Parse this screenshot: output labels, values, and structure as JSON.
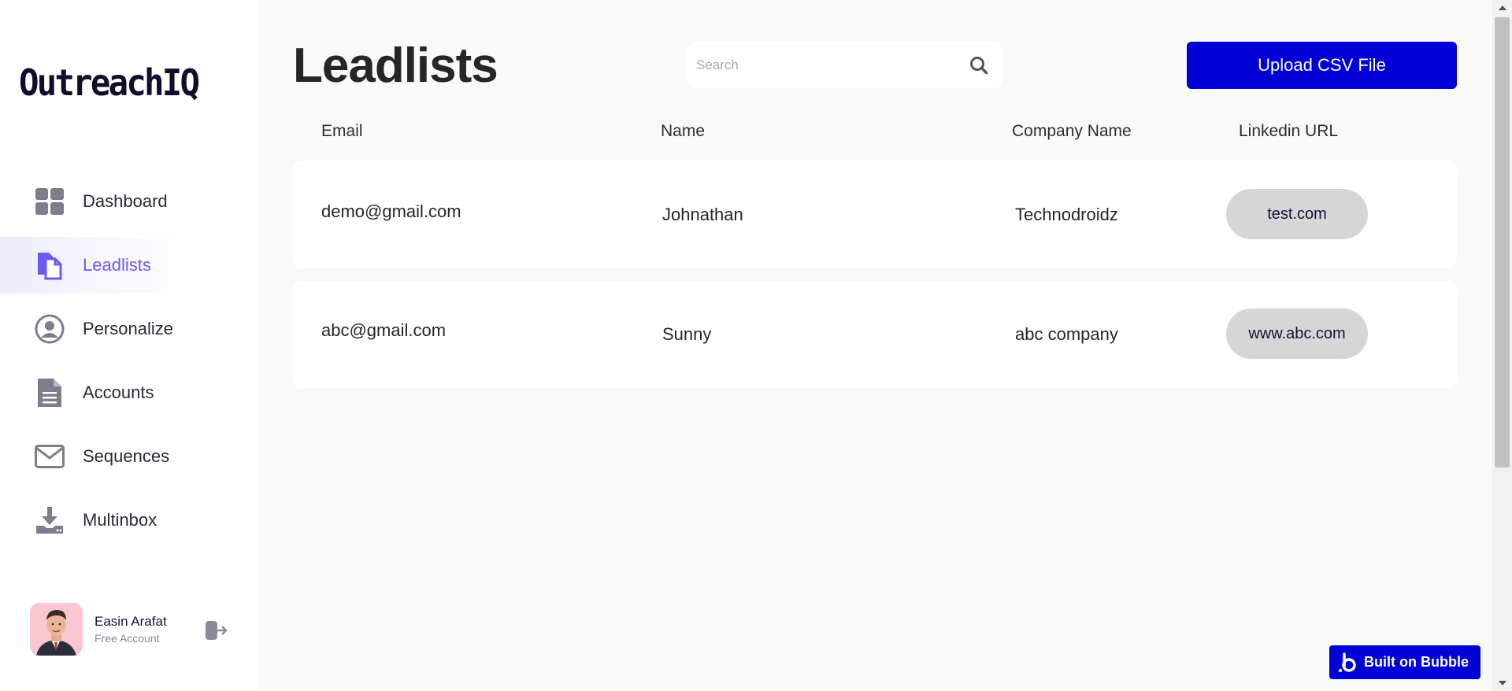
{
  "sidebar": {
    "logo": "OutreachIQ",
    "items": [
      {
        "label": "Dashboard",
        "icon": "dashboard-grid-icon"
      },
      {
        "label": "Leadlists",
        "icon": "leadlists-icon",
        "active": true
      },
      {
        "label": "Personalize",
        "icon": "user-circle-icon"
      },
      {
        "label": "Accounts",
        "icon": "document-icon"
      },
      {
        "label": "Sequences",
        "icon": "envelope-icon"
      },
      {
        "label": "Multinbox",
        "icon": "download-tray-icon"
      }
    ],
    "profile": {
      "name": "Easin Arafat",
      "plan": "Free Account",
      "logout_icon": "logout-icon"
    }
  },
  "header": {
    "title": "Leadlists",
    "search_placeholder": "Search",
    "search_value": "",
    "upload_label": "Upload CSV File"
  },
  "table": {
    "columns": [
      "Email",
      "Name",
      "Company Name",
      "Linkedin URL"
    ],
    "rows": [
      {
        "email": "demo@gmail.com",
        "name": "Johnathan",
        "company": "Technodroidz",
        "linkedin": "test.com"
      },
      {
        "email": "abc@gmail.com",
        "name": "Sunny",
        "company": "abc company",
        "linkedin": "www.abc.com"
      }
    ]
  },
  "footer": {
    "bubble_badge": "Built on Bubble"
  },
  "colors": {
    "accent": "#0000d6",
    "active_nav": "#6a5cf0",
    "icon_gray": "#7d7d8c",
    "pill": "#d6d6d6"
  }
}
